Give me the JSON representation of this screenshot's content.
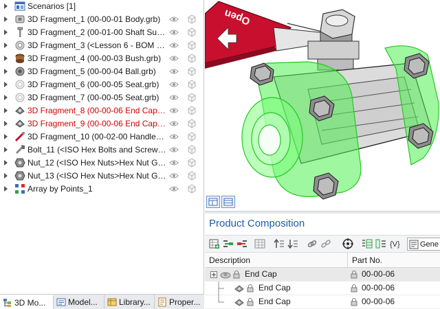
{
  "tree": {
    "scenarios_label": "Scenarios [1]",
    "items": [
      {
        "label": "3D Fragment_1 (00-00-01 Body.grb)",
        "red": false,
        "icon": "body-part-icon"
      },
      {
        "label": "3D Fragment_2 (00-01-00 Shaft Suba...",
        "red": false,
        "icon": "shaft-part-icon"
      },
      {
        "label": "3D Fragment_3 (<Lesson 6 - BOM an...",
        "red": false,
        "icon": "ring-part-icon"
      },
      {
        "label": "3D Fragment_4 (00-00-03 Bush.grb)",
        "red": false,
        "icon": "bush-part-icon"
      },
      {
        "label": "3D Fragment_5 (00-00-04 Ball.grb)",
        "red": false,
        "icon": "ball-part-icon"
      },
      {
        "label": "3D Fragment_6 (00-00-05 Seat.grb)",
        "red": false,
        "icon": "seat-part-icon"
      },
      {
        "label": "3D Fragment_7 (00-00-05 Seat.grb)",
        "red": false,
        "icon": "seat-part-icon"
      },
      {
        "label": "3D Fragment_8 (00-00-06 End Cap.gr...",
        "red": true,
        "icon": "endcap-part-icon"
      },
      {
        "label": "3D Fragment_9 (00-00-06 End Cap.gr...",
        "red": true,
        "icon": "endcap-part-icon"
      },
      {
        "label": "3D Fragment_10 (00-02-00 Handle S...",
        "red": false,
        "icon": "handle-part-icon"
      },
      {
        "label": "Bolt_11 (<ISO Hex Bolts and Screws>...",
        "red": false,
        "icon": "bolt-part-icon"
      },
      {
        "label": "Nut_12 (<ISO Hex Nuts>Hex Nut Gr...",
        "red": false,
        "icon": "nut-part-icon"
      },
      {
        "label": "Nut_13 (<ISO Hex Nuts>Hex Nut Gr...",
        "red": false,
        "icon": "nut-part-icon"
      },
      {
        "label": "Array by Points_1",
        "red": false,
        "icon": "array-icon"
      }
    ]
  },
  "left_tabs": [
    {
      "label": "3D Mo...",
      "icon": "model-tree-icon",
      "active": true
    },
    {
      "label": "Model...",
      "icon": "model-menu-icon",
      "active": false
    },
    {
      "label": "Library...",
      "icon": "library-icon",
      "active": false
    },
    {
      "label": "Proper...",
      "icon": "properties-icon",
      "active": false
    }
  ],
  "viewport": {
    "handle_text": "Open"
  },
  "product_composition": {
    "title": "Product Composition",
    "combo_value": "Gene",
    "columns": [
      "Description",
      "Part No."
    ],
    "rows": [
      {
        "description": "End Cap",
        "part_no": "00-00-06",
        "level": 0,
        "selected": true
      },
      {
        "description": "End Cap",
        "part_no": "00-00-06",
        "level": 1,
        "selected": false
      },
      {
        "description": "End Cap",
        "part_no": "00-00-06",
        "level": 1,
        "selected": false
      }
    ]
  },
  "colors": {
    "highlight_green": "#3cff3c",
    "handle_red": "#c8102e",
    "selected_red_text": "#d00000",
    "title_blue": "#1f5aa6"
  }
}
